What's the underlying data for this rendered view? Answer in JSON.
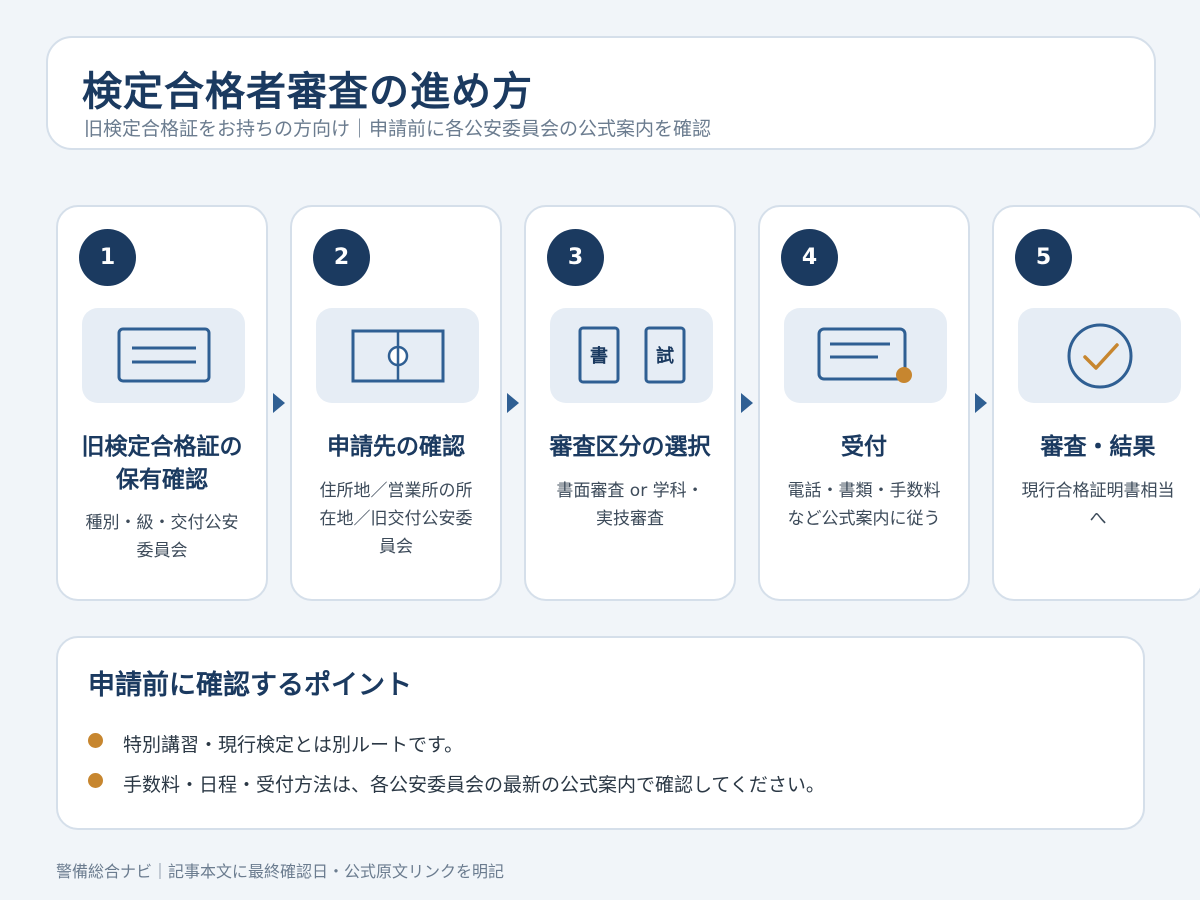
{
  "header": {
    "title": "検定合格者審査の進め方",
    "subtitle": "旧検定合格証をお持ちの方向け｜申請前に各公安委員会の公式案内を確認"
  },
  "steps": [
    {
      "number": "1",
      "icon": "id-card-icon",
      "title_line1": "旧検定合格証の",
      "title_line2": "保有確認",
      "desc_line1": "種別・級・交付公安",
      "desc_line2": "委員会",
      "desc_line3": ""
    },
    {
      "number": "2",
      "icon": "map-location-icon",
      "title_line1": "申請先の確認",
      "title_line2": "",
      "desc_line1": "住所地／営業所の所",
      "desc_line2": "在地／旧交付公安委",
      "desc_line3": "員会"
    },
    {
      "number": "3",
      "icon": "documents-icon",
      "icon_label_a": "書",
      "icon_label_b": "試",
      "title_line1": "審査区分の選択",
      "title_line2": "",
      "desc_line1": "書面審査 or 学科・",
      "desc_line2": "実技審査",
      "desc_line3": ""
    },
    {
      "number": "4",
      "icon": "application-form-icon",
      "title_line1": "受付",
      "title_line2": "",
      "desc_line1": "電話・書類・手数料",
      "desc_line2": "など公式案内に従う",
      "desc_line3": ""
    },
    {
      "number": "5",
      "icon": "check-circle-icon",
      "title_line1": "審査・結果",
      "title_line2": "",
      "desc_line1": "現行合格証明書相当",
      "desc_line2": "へ",
      "desc_line3": ""
    }
  ],
  "points": {
    "title": "申請前に確認するポイント",
    "items": [
      "特別講習・現行検定とは別ルートです。",
      "手数料・日程・受付方法は、各公安委員会の最新の公式案内で確認してください。"
    ]
  },
  "footer": "警備総合ナビ｜記事本文に最終確認日・公式原文リンクを明記",
  "colors": {
    "navy": "#1b3a60",
    "accent": "#c7862f",
    "icon_bg": "#e6edf5",
    "arrow": "#2f5f93"
  }
}
